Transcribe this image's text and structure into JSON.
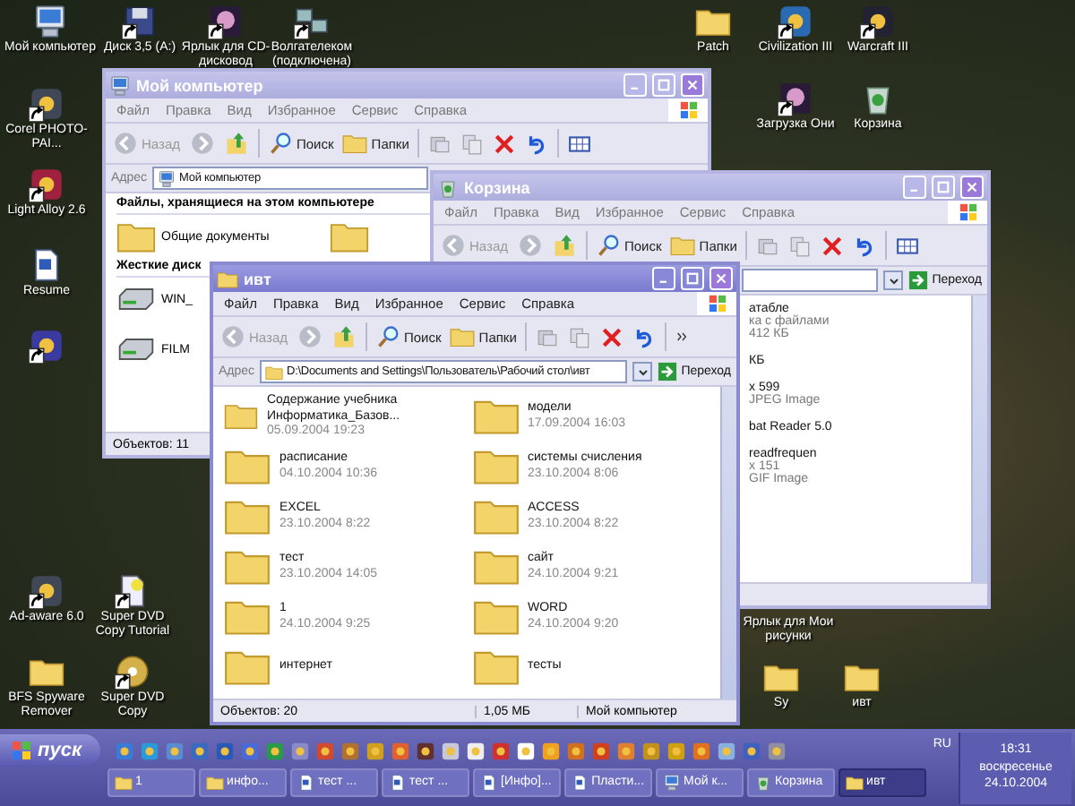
{
  "desktop_icons": [
    {
      "label": "Мой компьютер",
      "kind": "computer",
      "shortcut": false
    },
    {
      "label": "Диск 3,5 (A:)",
      "kind": "floppy",
      "shortcut": true
    },
    {
      "label": "Ярлык для CD-дисковод",
      "kind": "picture",
      "shortcut": true
    },
    {
      "label": "Волгателеком (подключена)",
      "kind": "network",
      "shortcut": true
    },
    {
      "label": "Corel PHOTO-PAI...",
      "kind": "app",
      "shortcut": true
    },
    {
      "label": "Light Alloy 2.6",
      "kind": "app",
      "shortcut": true
    },
    {
      "label": "Resume",
      "kind": "document",
      "shortcut": false
    },
    {
      "kind": "app",
      "shortcut": true
    },
    {
      "label": "Patch",
      "kind": "folder",
      "shortcut": false
    },
    {
      "label": "Civilization III",
      "kind": "app",
      "shortcut": true
    },
    {
      "label": "Warcraft III",
      "kind": "app",
      "shortcut": true
    },
    {
      "label": "Загрузка Они",
      "kind": "picture",
      "shortcut": true
    },
    {
      "label": "Корзина",
      "kind": "bin",
      "shortcut": false
    },
    {
      "label": "Ad-aware 6.0",
      "kind": "app",
      "shortcut": true
    },
    {
      "label": "Super DVD Copy Tutorial",
      "kind": "page",
      "shortcut": true
    },
    {
      "label": "BFS Spyware Remover",
      "kind": "folder",
      "shortcut": false
    },
    {
      "label": "Super DVD Copy",
      "kind": "disc",
      "shortcut": true
    },
    {
      "label": "Ярлык для Мои рисунки",
      "kind": "none"
    },
    {
      "label": "Sy",
      "kind": "folder",
      "shortcut": false
    },
    {
      "label": "ивт",
      "kind": "folder",
      "shortcut": false
    }
  ],
  "windows": [
    {
      "kind": "mycomputer",
      "title": "Мой компьютер",
      "active": false,
      "menu": [
        "Файл",
        "Правка",
        "Вид",
        "Избранное",
        "Сервис",
        "Справка"
      ],
      "toolbar": {
        "back": "Назад",
        "search": "Поиск",
        "folders": "Папки"
      },
      "address": {
        "label": "Адрес",
        "value": "Мой компьютер"
      },
      "sections": [
        {
          "heading": "Файлы, хранящиеся на этом компьютере",
          "items": [
            {
              "label": "Общие документы",
              "kind": "folder"
            },
            {
              "kind": "folder"
            }
          ]
        },
        {
          "heading": "Жесткие диск",
          "items": [
            {
              "label": "WIN_",
              "kind": "drive"
            },
            {
              "label": "FILM",
              "kind": "drive"
            }
          ]
        }
      ],
      "status": [
        "Объектов: 11"
      ]
    },
    {
      "kind": "recycle",
      "title": "Корзина",
      "active": false,
      "menu": [
        "Файл",
        "Правка",
        "Вид",
        "Избранное",
        "Сервис",
        "Справка"
      ],
      "toolbar": {
        "back": "Назад",
        "search": "Поиск",
        "folders": "Папки"
      },
      "go_button": "Переход",
      "fragments": [
        [
          "атабле",
          "ка с файлами",
          "412 КБ"
        ],
        [
          "КБ"
        ],
        [
          "x 599",
          "JPEG Image"
        ],
        [
          "bat Reader 5.0"
        ],
        [
          "readfrequen",
          "x 151",
          "GIF Image"
        ]
      ]
    },
    {
      "kind": "folder",
      "title": "ивт",
      "active": true,
      "menu": [
        "Файл",
        "Правка",
        "Вид",
        "Избранное",
        "Сервис",
        "Справка"
      ],
      "toolbar": {
        "back": "Назад",
        "search": "Поиск",
        "folders": "Папки"
      },
      "address": {
        "label": "Адрес",
        "value": "D:\\Documents and Settings\\Пользователь\\Рабочий стол\\ивт"
      },
      "go_button": "Переход",
      "files": [
        {
          "name": "Содержание учебника Информатика_Базов...",
          "date": "05.09.2004 19:23"
        },
        {
          "name": "модели",
          "date": "17.09.2004 16:03"
        },
        {
          "name": "расписание",
          "date": "04.10.2004 10:36"
        },
        {
          "name": "системы счисления",
          "date": "23.10.2004 8:06"
        },
        {
          "name": "EXCEL",
          "date": "23.10.2004 8:22"
        },
        {
          "name": "ACCESS",
          "date": "23.10.2004 8:22"
        },
        {
          "name": "тест",
          "date": "23.10.2004 14:05"
        },
        {
          "name": "сайт",
          "date": "24.10.2004 9:21"
        },
        {
          "name": "1",
          "date": "24.10.2004 9:25"
        },
        {
          "name": "WORD",
          "date": "24.10.2004 9:20"
        },
        {
          "name": "интернет"
        },
        {
          "name": "тесты"
        }
      ],
      "status": [
        "Объектов: 20",
        "1,05 МБ",
        "Мой компьютер"
      ]
    }
  ],
  "taskbar": {
    "start": "пуск",
    "tasks": [
      {
        "label": "1",
        "kind": "folder",
        "selected": false
      },
      {
        "label": "инфо...",
        "kind": "folder",
        "selected": false
      },
      {
        "label": "тест ...",
        "kind": "document",
        "selected": false
      },
      {
        "label": "тест ...",
        "kind": "document",
        "selected": false
      },
      {
        "label": "[Инфо]...",
        "kind": "document",
        "selected": false
      },
      {
        "label": "Пласти...",
        "kind": "document",
        "selected": false
      },
      {
        "label": "Мой к...",
        "kind": "computer",
        "selected": false
      },
      {
        "label": "Корзина",
        "kind": "bin",
        "selected": false
      },
      {
        "label": "ивт",
        "kind": "folder",
        "selected": true
      }
    ],
    "language": "RU",
    "time": "18:31",
    "day": "воскресенье",
    "date": "24.10.2004"
  }
}
